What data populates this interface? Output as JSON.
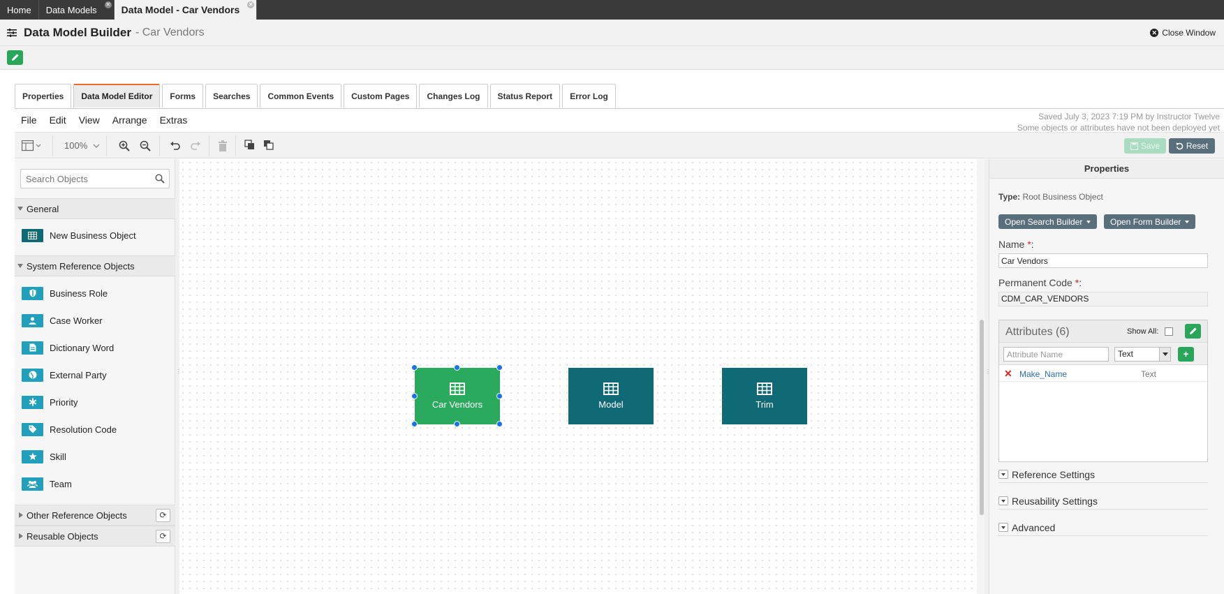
{
  "top_tabs": [
    {
      "label": "Home"
    },
    {
      "label": "Data Models"
    },
    {
      "label": "Data Model - Car Vendors"
    }
  ],
  "header": {
    "title": "Data Model Builder",
    "subtitle": "- Car Vendors",
    "close_window": "Close Window"
  },
  "section_tabs": [
    "Properties",
    "Data Model Editor",
    "Forms",
    "Searches",
    "Common Events",
    "Custom Pages",
    "Changes Log",
    "Status Report",
    "Error Log"
  ],
  "active_tab": "Data Model Editor",
  "menu": [
    "File",
    "Edit",
    "View",
    "Arrange",
    "Extras"
  ],
  "saved_info": {
    "line1": "Saved July 3, 2023 7:19 PM by Instructor Twelve",
    "line2": "Some objects or attributes have not been deployed yet"
  },
  "toolbar": {
    "zoom": "100%",
    "save_label": "Save",
    "reset_label": "Reset"
  },
  "left_panel": {
    "search_placeholder": "Search Objects",
    "general": {
      "label": "General",
      "items": [
        {
          "label": "New Business Object",
          "icon": "table-icon"
        }
      ]
    },
    "system_ref": {
      "label": "System Reference Objects",
      "items": [
        {
          "label": "Business Role",
          "icon": "shield-icon"
        },
        {
          "label": "Case Worker",
          "icon": "user-icon"
        },
        {
          "label": "Dictionary Word",
          "icon": "document-icon"
        },
        {
          "label": "External Party",
          "icon": "globe-icon"
        },
        {
          "label": "Priority",
          "icon": "asterisk-icon"
        },
        {
          "label": "Resolution Code",
          "icon": "tag-icon"
        },
        {
          "label": "Skill",
          "icon": "star-icon"
        },
        {
          "label": "Team",
          "icon": "users-icon"
        }
      ]
    },
    "other_ref": {
      "label": "Other Reference Objects"
    },
    "reusable": {
      "label": "Reusable Objects"
    }
  },
  "diagram": {
    "nodes": [
      {
        "label": "Car Vendors",
        "selected": true,
        "color": "#2aaa5c"
      },
      {
        "label": "Model",
        "selected": false,
        "color": "#0f6a76"
      },
      {
        "label": "Trim",
        "selected": false,
        "color": "#0f6a76"
      }
    ],
    "relations": [
      {
        "from": "Car Vendors",
        "to": "Model",
        "type": "one-to-many"
      },
      {
        "from": "Model",
        "to": "Trim",
        "type": "one-to-many"
      }
    ]
  },
  "properties": {
    "title": "Properties",
    "type_label": "Type:",
    "type_value": "Root Business Object",
    "open_search_builder": "Open Search Builder",
    "open_form_builder": "Open Form Builder",
    "name_label": "Name",
    "name_value": "Car Vendors",
    "code_label": "Permanent Code",
    "code_value": "CDM_CAR_VENDORS",
    "attributes_title": "Attributes (6)",
    "show_all": "Show All:",
    "attr_name_placeholder": "Attribute Name",
    "attr_type_selected": "Text",
    "attributes": [
      {
        "name": "Make_Name",
        "type": "Text"
      }
    ],
    "sections": [
      "Reference Settings",
      "Reusability Settings",
      "Advanced"
    ]
  },
  "colors": {
    "accent_green": "#2aa65a",
    "node_teal": "#0f6a76",
    "icon_teal": "#22a0bb",
    "active_tab_border": "#f06a2a",
    "button_slate": "#5a6f7c"
  }
}
